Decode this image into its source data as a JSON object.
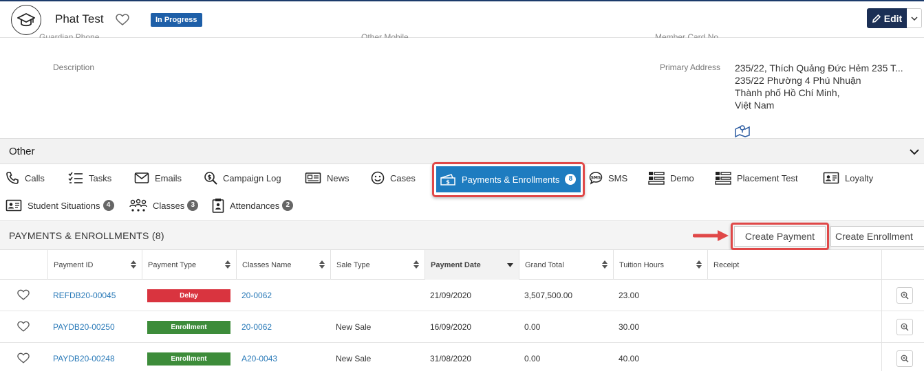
{
  "header": {
    "title": "Phat Test",
    "status": "In Progress",
    "edit_label": "Edit"
  },
  "details": {
    "cut_labels": [
      "Guardian Phone",
      "Other Mobile",
      "Member Card No."
    ],
    "description_label": "Description",
    "primary_address_label": "Primary Address",
    "address_lines": [
      "235/22, Thích Quảng Đức Hẻm 235 T...",
      "235/22 Phường 4 Phú Nhuận",
      "Thành phố Hồ Chí Minh,",
      "Việt Nam"
    ]
  },
  "section": {
    "title": "Other"
  },
  "tabs": [
    {
      "label": "Calls",
      "icon": "phone-icon"
    },
    {
      "label": "Tasks",
      "icon": "checklist-icon"
    },
    {
      "label": "Emails",
      "icon": "envelope-icon"
    },
    {
      "label": "Campaign Log",
      "icon": "dollar-search-icon"
    },
    {
      "label": "News",
      "icon": "newspaper-icon"
    },
    {
      "label": "Cases",
      "icon": "smiley-icon"
    },
    {
      "label": "Payments & Enrollments",
      "icon": "payment-ticket-icon",
      "count": "8",
      "active": true
    },
    {
      "label": "SMS",
      "icon": "sms-icon"
    },
    {
      "label": "Demo",
      "icon": "demo-icon"
    },
    {
      "label": "Placement Test",
      "icon": "placement-icon"
    },
    {
      "label": "Loyalty",
      "icon": "id-card-icon"
    },
    {
      "label": "Student Situations",
      "icon": "student-card-icon",
      "count": "4"
    },
    {
      "label": "Classes",
      "icon": "group-icon",
      "count": "3"
    },
    {
      "label": "Attendances",
      "icon": "clipboard-icon",
      "count": "2"
    }
  ],
  "list": {
    "title": "PAYMENTS & ENROLLMENTS (8)",
    "create_payment": "Create Payment",
    "create_enrollment": "Create Enrollment",
    "columns": [
      "Payment ID",
      "Payment Type",
      "Classes Name",
      "Sale Type",
      "Payment Date",
      "Grand Total",
      "Tuition Hours",
      "Receipt"
    ],
    "rows": [
      {
        "payment_id": "REFDB20-00045",
        "payment_type": "Delay",
        "class": "20-0062",
        "sale_type": "",
        "date": "21/09/2020",
        "total": "3,507,500.00",
        "hours": "23.00",
        "receipt": ""
      },
      {
        "payment_id": "PAYDB20-00250",
        "payment_type": "Enrollment",
        "class": "20-0062",
        "sale_type": "New Sale",
        "date": "16/09/2020",
        "total": "0.00",
        "hours": "30.00",
        "receipt": ""
      },
      {
        "payment_id": "PAYDB20-00248",
        "payment_type": "Enrollment",
        "class": "A20-0043",
        "sale_type": "New Sale",
        "date": "31/08/2020",
        "total": "0.00",
        "hours": "40.00",
        "receipt": ""
      }
    ]
  },
  "colors": {
    "active_tab": "#1e7cc0",
    "highlight": "#e04848",
    "delay": "#d9343f",
    "enrollment": "#3d8c3a",
    "link": "#2a7ab8",
    "edit_button": "#1b2f55"
  }
}
